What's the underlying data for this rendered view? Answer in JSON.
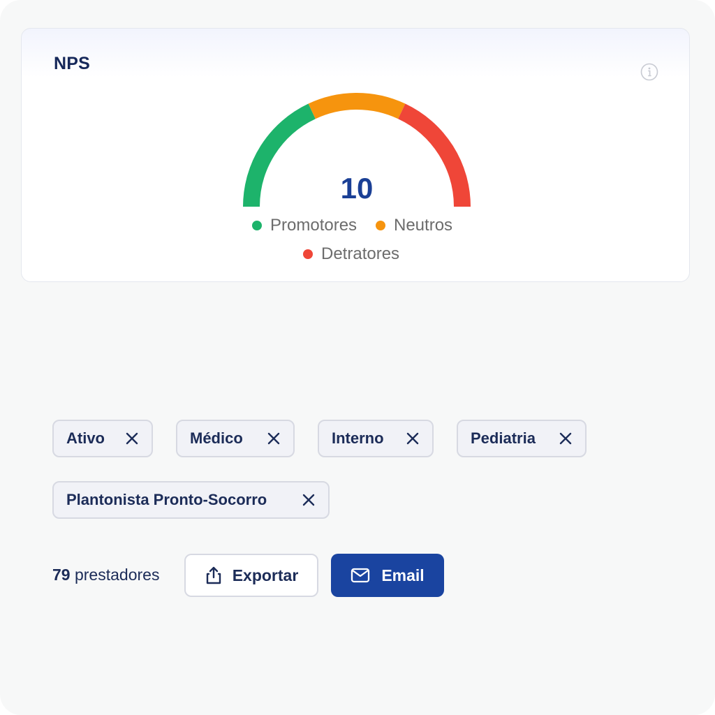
{
  "card": {
    "title": "NPS",
    "info_icon": "info-icon",
    "gauge": {
      "value": "10",
      "segments": [
        {
          "name": "Promotores",
          "color": "#1db36b",
          "fraction": 0.36
        },
        {
          "name": "Neutros",
          "color": "#f6940e",
          "fraction": 0.28
        },
        {
          "name": "Detratores",
          "color": "#ef4638",
          "fraction": 0.36
        }
      ]
    },
    "legend": [
      {
        "label": "Promotores",
        "color": "#1db36b"
      },
      {
        "label": "Neutros",
        "color": "#f6940e"
      },
      {
        "label": "Detratores",
        "color": "#ef4638"
      }
    ]
  },
  "filters": {
    "chips": [
      {
        "label": "Ativo"
      },
      {
        "label": "Médico"
      },
      {
        "label": "Interno"
      },
      {
        "label": "Pediatria"
      },
      {
        "label": "Plantonista Pronto-Socorro"
      }
    ],
    "remove_icon": "close-icon"
  },
  "results": {
    "count": "79",
    "count_suffix": "prestadores"
  },
  "actions": {
    "export_label": "Exportar",
    "export_icon": "share-export-icon",
    "email_label": "Email",
    "email_icon": "envelope-icon"
  },
  "colors": {
    "primary": "#1a44a0",
    "title_text": "#16285a",
    "gauge_value": "#1a3f95"
  }
}
